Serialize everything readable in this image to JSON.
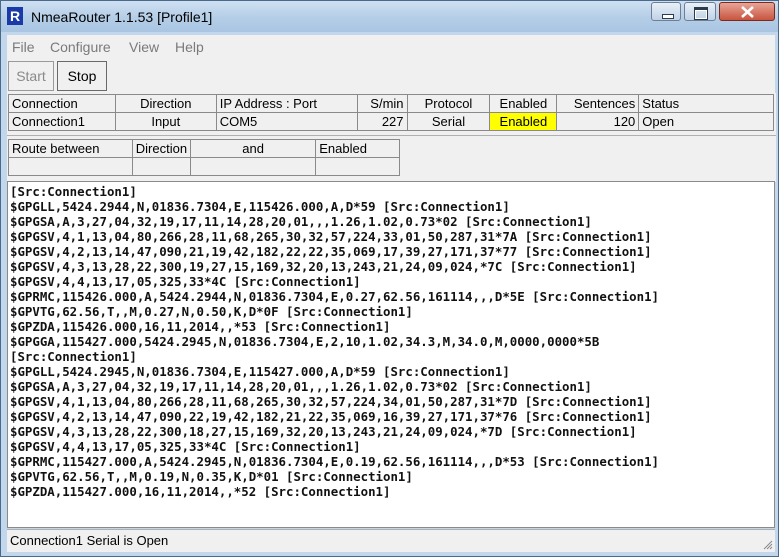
{
  "window": {
    "icon_letter": "R",
    "title": "NmeaRouter 1.1.53  [Profile1]"
  },
  "menu": {
    "items": [
      "File",
      "Configure",
      "View",
      "Help"
    ]
  },
  "toolbar": {
    "start_label": "Start",
    "stop_label": "Stop"
  },
  "connections": {
    "headers": [
      "Connection",
      "Direction",
      "IP Address : Port",
      "S/min",
      "Protocol",
      "Enabled",
      "Sentences",
      "Status"
    ],
    "rows": [
      [
        "Connection1",
        "Input",
        "COM5",
        "227",
        "Serial",
        "Enabled",
        "120",
        "Open"
      ]
    ],
    "enabled_color": "#ffff00"
  },
  "routes": {
    "headers": [
      "Route between",
      "Direction",
      "and",
      "Enabled"
    ]
  },
  "log": {
    "lines": [
      "[Src:Connection1]",
      "$GPGLL,5424.2944,N,01836.7304,E,115426.000,A,D*59 [Src:Connection1]",
      "$GPGSA,A,3,27,04,32,19,17,11,14,28,20,01,,,1.26,1.02,0.73*02 [Src:Connection1]",
      "$GPGSV,4,1,13,04,80,266,28,11,68,265,30,32,57,224,33,01,50,287,31*7A [Src:Connection1]",
      "$GPGSV,4,2,13,14,47,090,21,19,42,182,22,22,35,069,17,39,27,171,37*77 [Src:Connection1]",
      "$GPGSV,4,3,13,28,22,300,19,27,15,169,32,20,13,243,21,24,09,024,*7C [Src:Connection1]",
      "$GPGSV,4,4,13,17,05,325,33*4C [Src:Connection1]",
      "$GPRMC,115426.000,A,5424.2944,N,01836.7304,E,0.27,62.56,161114,,,D*5E [Src:Connection1]",
      "$GPVTG,62.56,T,,M,0.27,N,0.50,K,D*0F [Src:Connection1]",
      "$GPZDA,115426.000,16,11,2014,,*53 [Src:Connection1]",
      "$GPGGA,115427.000,5424.2945,N,01836.7304,E,2,10,1.02,34.3,M,34.0,M,0000,0000*5B",
      "[Src:Connection1]",
      "$GPGLL,5424.2945,N,01836.7304,E,115427.000,A,D*59 [Src:Connection1]",
      "$GPGSA,A,3,27,04,32,19,17,11,14,28,20,01,,,1.26,1.02,0.73*02 [Src:Connection1]",
      "$GPGSV,4,1,13,04,80,266,28,11,68,265,30,32,57,224,34,01,50,287,31*7D [Src:Connection1]",
      "$GPGSV,4,2,13,14,47,090,22,19,42,182,21,22,35,069,16,39,27,171,37*76 [Src:Connection1]",
      "$GPGSV,4,3,13,28,22,300,18,27,15,169,32,20,13,243,21,24,09,024,*7D [Src:Connection1]",
      "$GPGSV,4,4,13,17,05,325,33*4C [Src:Connection1]",
      "$GPRMC,115427.000,A,5424.2945,N,01836.7304,E,0.19,62.56,161114,,,D*53 [Src:Connection1]",
      "$GPVTG,62.56,T,,M,0.19,N,0.35,K,D*01 [Src:Connection1]",
      "$GPZDA,115427.000,16,11,2014,,*52 [Src:Connection1]"
    ]
  },
  "status": {
    "text": "Connection1 Serial is Open"
  }
}
